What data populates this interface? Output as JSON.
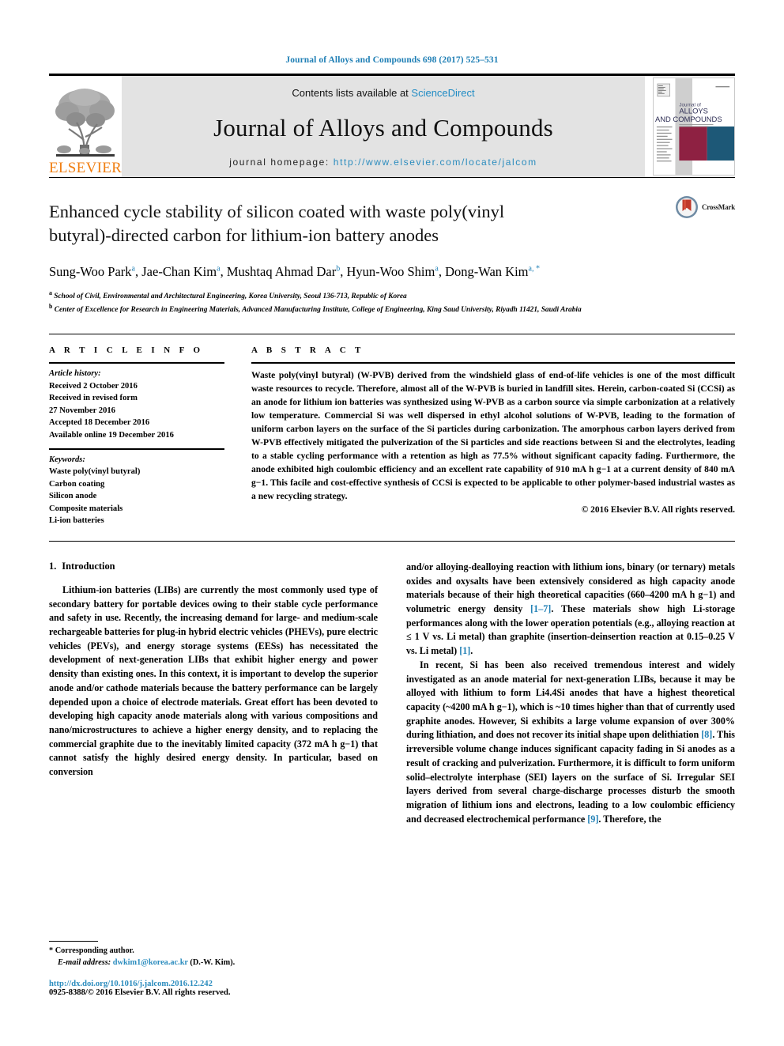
{
  "running_head": "Journal of Alloys and Compounds 698 (2017) 525–531",
  "masthead": {
    "contents_prefix": "Contents lists available at ",
    "sciencedirect": "ScienceDirect",
    "journal_name": "Journal of Alloys and Compounds",
    "homepage_label": "journal homepage: ",
    "homepage_url": "http://www.elsevier.com/locate/jalcom",
    "publisher_wordmark": "ELSEVIER",
    "cover": {
      "line1": "Journal of",
      "line2": "ALLOYS",
      "line3": "AND COMPOUNDS"
    },
    "link_color": "#1f8bc4"
  },
  "article": {
    "title": "Enhanced cycle stability of silicon coated with waste poly(vinyl butyral)-directed carbon for lithium-ion battery anodes",
    "authors": [
      {
        "name": "Sung-Woo Park",
        "marks": "a",
        "sep": ", "
      },
      {
        "name": "Jae-Chan Kim",
        "marks": "a",
        "sep": ", "
      },
      {
        "name": "Mushtaq Ahmad Dar",
        "marks": "b",
        "sep": ", "
      },
      {
        "name": "Hyun-Woo Shim",
        "marks": "a",
        "sep": ", "
      },
      {
        "name": "Dong-Wan Kim",
        "marks": "a, *",
        "sep": ""
      }
    ],
    "affiliations": [
      {
        "mark": "a",
        "text": "School of Civil, Environmental and Architectural Engineering, Korea University, Seoul 136-713, Republic of Korea"
      },
      {
        "mark": "b",
        "text": "Center of Excellence for Research in Engineering Materials, Advanced Manufacturing Institute, College of Engineering, King Saud University, Riyadh 11421, Saudi Arabia"
      }
    ],
    "crossmark_label": "CrossMark"
  },
  "article_info": {
    "heading": "A R T I C L E   I N F O",
    "history_label": "Article history:",
    "history": [
      "Received 2 October 2016",
      "Received in revised form",
      "27 November 2016",
      "Accepted 18 December 2016",
      "Available online 19 December 2016"
    ],
    "keywords_label": "Keywords:",
    "keywords": [
      "Waste poly(vinyl butyral)",
      "Carbon coating",
      "Silicon anode",
      "Composite materials",
      "Li-ion batteries"
    ]
  },
  "abstract": {
    "heading": "A B S T R A C T",
    "text": "Waste poly(vinyl butyral) (W-PVB) derived from the windshield glass of end-of-life vehicles is one of the most difficult waste resources to recycle. Therefore, almost all of the W-PVB is buried in landfill sites. Herein, carbon-coated Si (CCSi) as an anode for lithium ion batteries was synthesized using W-PVB as a carbon source via simple carbonization at a relatively low temperature. Commercial Si was well dispersed in ethyl alcohol solutions of W-PVB, leading to the formation of uniform carbon layers on the surface of the Si particles during carbonization. The amorphous carbon layers derived from W-PVB effectively mitigated the pulverization of the Si particles and side reactions between Si and the electrolytes, leading to a stable cycling performance with a retention as high as 77.5% without significant capacity fading. Furthermore, the anode exhibited high coulombic efficiency and an excellent rate capability of 910 mA h g−1 at a current density of 840 mA g−1. This facile and cost-effective synthesis of CCSi is expected to be applicable to other polymer-based industrial wastes as a new recycling strategy.",
    "copyright": "© 2016 Elsevier B.V. All rights reserved."
  },
  "body": {
    "section_number": "1.",
    "section_title": "Introduction",
    "left_paragraphs": [
      "Lithium-ion batteries (LIBs) are currently the most commonly used type of secondary battery for portable devices owing to their stable cycle performance and safety in use. Recently, the increasing demand for large- and medium-scale rechargeable batteries for plug-in hybrid electric vehicles (PHEVs), pure electric vehicles (PEVs), and energy storage systems (EESs) has necessitated the development of next-generation LIBs that exhibit higher energy and power density than existing ones. In this context, it is important to develop the superior anode and/or cathode materials because the battery performance can be largely depended upon a choice of electrode materials. Great effort has been devoted to developing high capacity anode materials along with various compositions and nano/microstructures to achieve a higher energy density, and to replacing the commercial graphite due to the inevitably limited capacity (372 mA h g−1) that cannot satisfy the highly desired energy density. In particular, based on conversion"
    ],
    "right_paragraph_1_parts": [
      {
        "t": "and/or alloying-dealloying reaction with lithium ions, binary (or ternary) metals oxides and oxysalts have been extensively considered as high capacity anode materials because of their high theoretical capacities (660–4200 mA h g−1) and volumetric energy density ",
        "cite": false
      },
      {
        "t": "[1–7]",
        "cite": true
      },
      {
        "t": ". These materials show high Li-storage performances along with the lower operation potentials (e.g., alloying reaction at ≤ 1 V vs. Li metal) than graphite (insertion-deinsertion reaction at 0.15–0.25 V vs. Li metal) ",
        "cite": false
      },
      {
        "t": "[1]",
        "cite": true
      },
      {
        "t": ".",
        "cite": false
      }
    ],
    "right_paragraph_2_parts": [
      {
        "t": "In recent, Si has been also received tremendous interest and widely investigated as an anode material for next-generation LIBs, because it may be alloyed with lithium to form Li4.4Si anodes that have a highest theoretical capacity (~4200 mA h g−1), which is ~10 times higher than that of currently used graphite anodes. However, Si exhibits a large volume expansion of over 300% during lithiation, and does not recover its initial shape upon delithiation ",
        "cite": false
      },
      {
        "t": "[8]",
        "cite": true
      },
      {
        "t": ". This irreversible volume change induces significant capacity fading in Si anodes as a result of cracking and pulverization. Furthermore, it is difficult to form uniform solid–electrolyte interphase (SEI) layers on the surface of Si. Irregular SEI layers derived from several charge-discharge processes disturb the smooth migration of lithium ions and electrons, leading to a low coulombic efficiency and decreased electrochemical performance ",
        "cite": false
      },
      {
        "t": "[9]",
        "cite": true
      },
      {
        "t": ". Therefore, the",
        "cite": false
      }
    ]
  },
  "footnote": {
    "corresponding": "* Corresponding author.",
    "email_label": "E-mail address:",
    "email": "dwkim1@korea.ac.kr",
    "email_suffix": "(D.-W. Kim).",
    "doi": "http://dx.doi.org/10.1016/j.jalcom.2016.12.242",
    "issn": "0925-8388/© 2016 Elsevier B.V. All rights reserved."
  }
}
